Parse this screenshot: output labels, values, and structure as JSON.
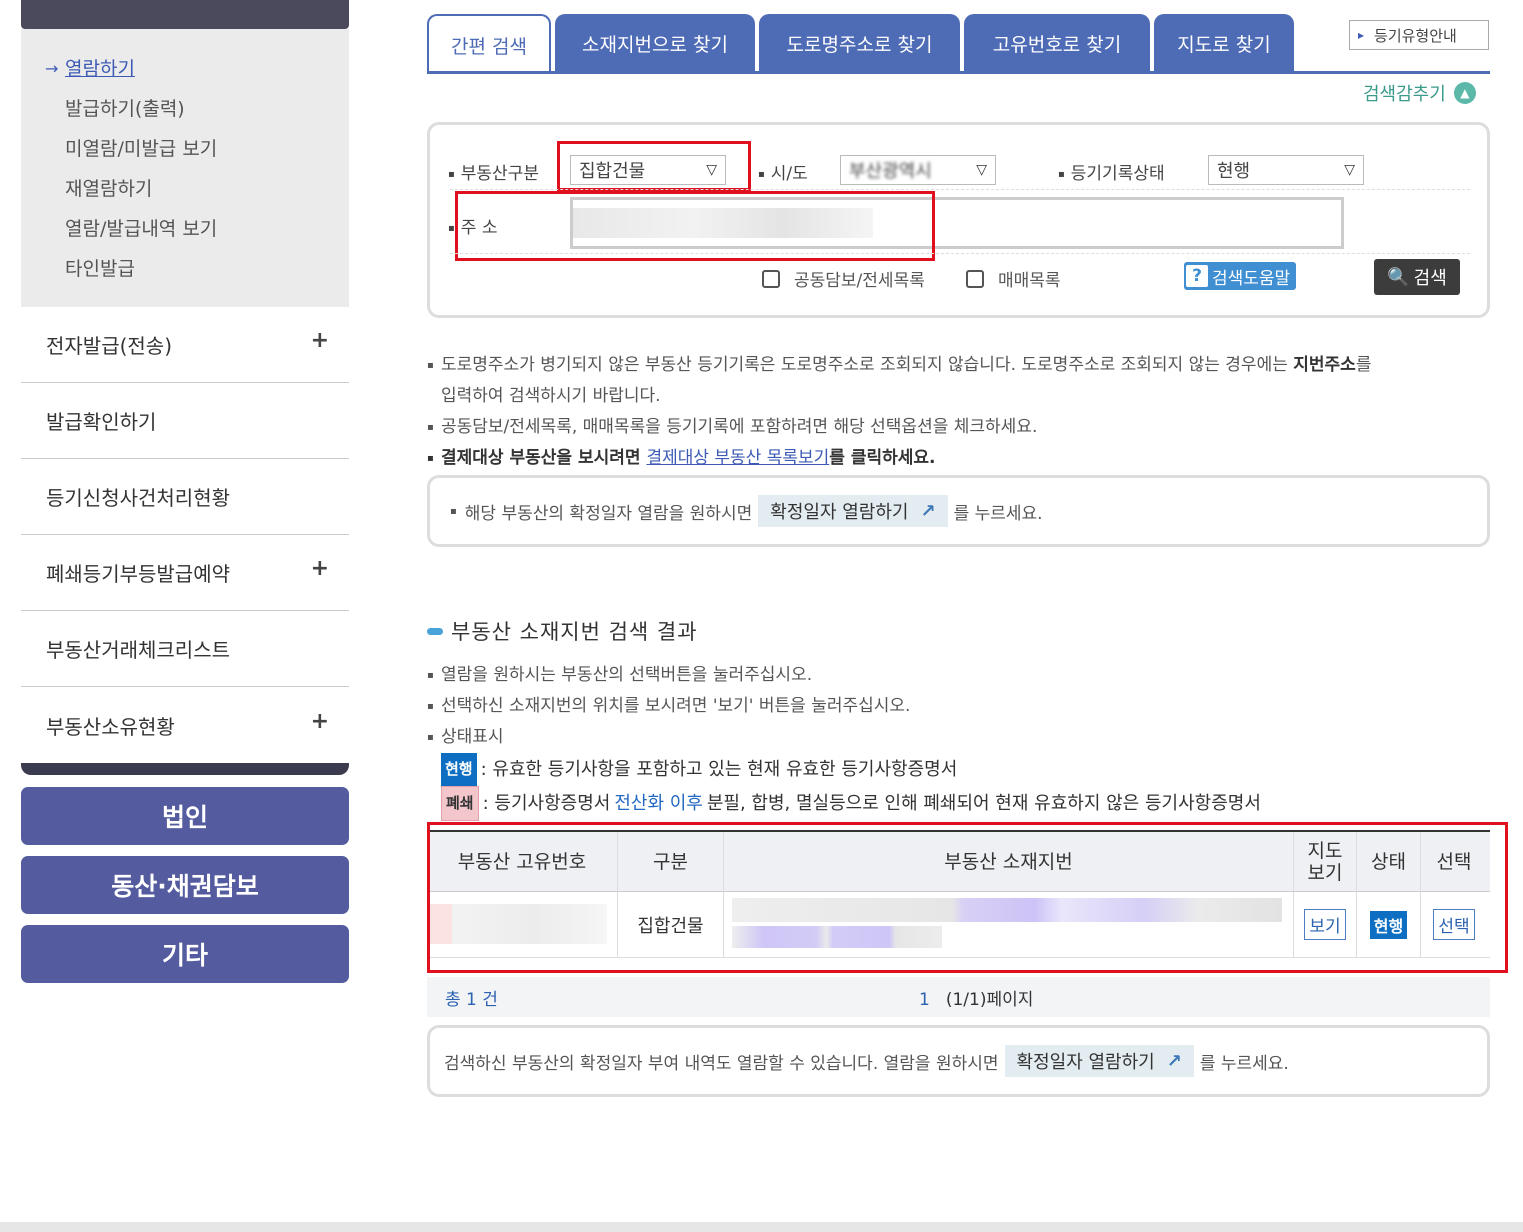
{
  "sidebar": {
    "sub_items": [
      {
        "label": "열람하기",
        "active": true
      },
      {
        "label": "발급하기(출력)"
      },
      {
        "label": "미열람/미발급 보기"
      },
      {
        "label": "재열람하기"
      },
      {
        "label": "열람/발급내역 보기"
      },
      {
        "label": "타인발급"
      }
    ],
    "menu_items": [
      {
        "label": "전자발급(전송)",
        "plus": "+"
      },
      {
        "label": "발급확인하기",
        "plus": ""
      },
      {
        "label": "등기신청사건처리현황",
        "plus": ""
      },
      {
        "label": "폐쇄등기부등발급예약",
        "plus": "+"
      },
      {
        "label": "부동산거래체크리스트",
        "plus": ""
      },
      {
        "label": "부동산소유현황",
        "plus": "+"
      }
    ],
    "buttons": [
      "법인",
      "동산·채권담보",
      "기타"
    ]
  },
  "tabs": [
    "간편 검색",
    "소재지번으로 찾기",
    "도로명주소로 찾기",
    "고유번호로 찾기",
    "지도로 찾기"
  ],
  "guide_button": "등기유형안내",
  "hide_search": "검색감추기",
  "search": {
    "type_label": "부동산구분",
    "type_value": "집합건물",
    "city_label": "시/도",
    "city_value": "부산광역시",
    "status_label": "등기기록상태",
    "status_value": "현행",
    "address_label": "주 소",
    "checkbox1": "공동담보/전세목록",
    "checkbox2": "매매목록",
    "help_button": "검색도움말",
    "search_button": "검색"
  },
  "notes": {
    "n1a": "도로명주소가 병기되지 않은 부동산 등기기록은 도로명주소로 조회되지 않습니다. 도로명주소로 조회되지 않는 경우에는 ",
    "n1b": "지번주소",
    "n1c": "를",
    "n1d": "입력하여 검색하시기 바랍니다.",
    "n2": "공동담보/전세목록, 매매목록을 등기기록에 포함하려면 해당 선택옵션을 체크하세요.",
    "n3a": "결제대상 부동산을 보시려면 ",
    "n3link": "결제대상 부동산 목록보기",
    "n3b": "를 클릭하세요."
  },
  "info1": {
    "pre": "해당 부동산의 확정일자 열람을 원하시면",
    "chip": "확정일자 열람하기",
    "post": "를 누르세요."
  },
  "result": {
    "title": "부동산 소재지번 검색 결과",
    "note1": "열람을 원하시는 부동산의 선택버튼을 눌러주십시오.",
    "note2": "선택하신 소재지번의 위치를 보시려면 '보기' 버튼을 눌러주십시오.",
    "note3": "상태표시",
    "status1_badge": "현행",
    "status1_text": ": 유효한 등기사항을 포함하고 있는 현재 유효한 등기사항증명서",
    "status2_badge": "폐쇄",
    "status2_pre": ": 등기사항증명서 ",
    "status2_blue": "전산화 이후",
    "status2_post": " 분필, 합병, 멸실등으로 인해 폐쇄되어 현재 유효하지 않은 등기사항증명서",
    "headers": [
      "부동산 고유번호",
      "구분",
      "부동산 소재지번",
      "지도\n보기",
      "상태",
      "선택"
    ],
    "row": {
      "type": "집합건물",
      "map": "보기",
      "status": "현행",
      "select": "선택"
    },
    "total": "총 1 건",
    "page_num": "1",
    "page_info": "(1/1)페이지"
  },
  "info2": {
    "pre": "검색하신 부동산의 확정일자 부여 내역도 열람할 수 있습니다. 열람을 원하시면",
    "chip": "확정일자 열람하기",
    "post": "를 누르세요."
  },
  "colors": {
    "accent": "#4e6bb6",
    "highlight": "#e0101e"
  }
}
